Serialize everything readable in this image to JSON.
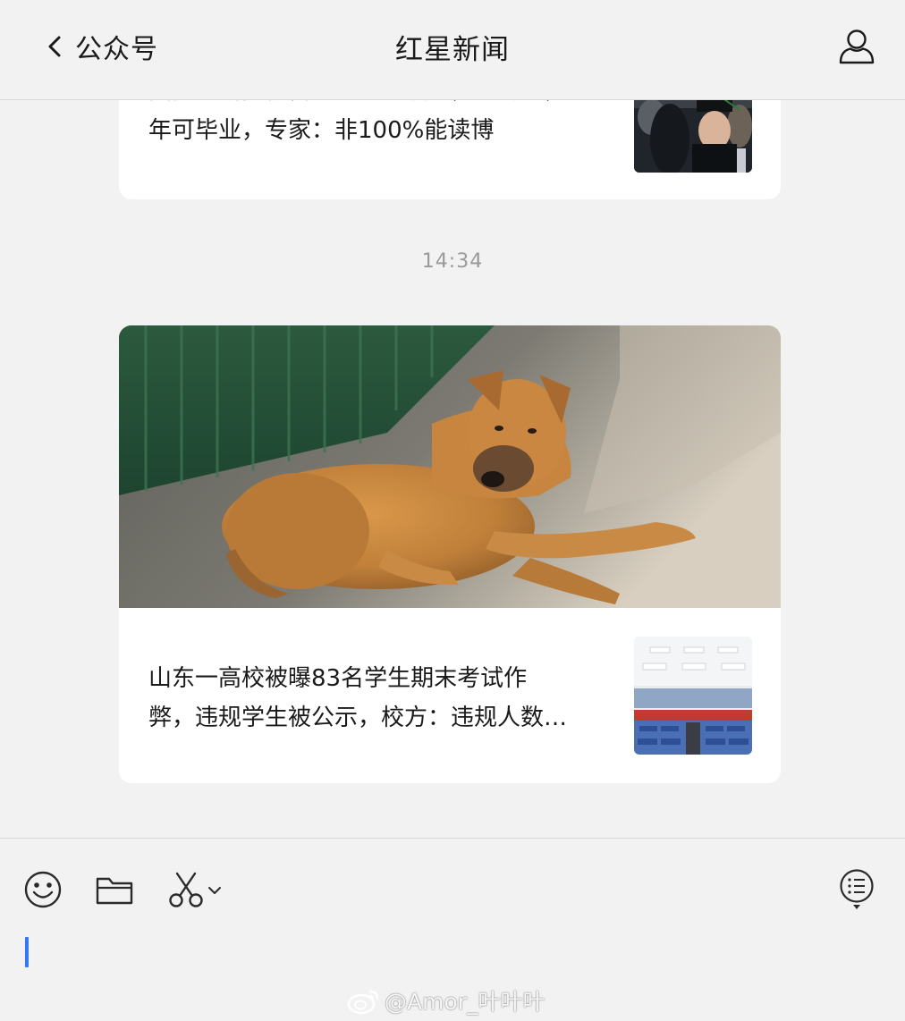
{
  "header": {
    "back_label": "公众号",
    "title": "红星新闻"
  },
  "messages": {
    "previous_article": {
      "title_partial_line": "国内大研多校自主一个特设建，特专业，",
      "title_line_2": "年可毕业，专家：非100%能读博"
    },
    "timestamp": "14:34",
    "article": {
      "title_line_1": "山东一高校被曝83名学生期末考试作",
      "title_line_2": "弊，违规学生被公示，校方：违规人数…"
    }
  },
  "toolbar": {
    "icons": [
      "emoji-icon",
      "folder-icon",
      "scissors-icon",
      "chevron-down-icon",
      "message-list-icon"
    ]
  },
  "watermark": "@Amor_叶叶叶",
  "colors": {
    "background": "#f2f2f2",
    "card": "#ffffff",
    "caret": "#3478f6",
    "timestamp": "#9a9a9a"
  }
}
